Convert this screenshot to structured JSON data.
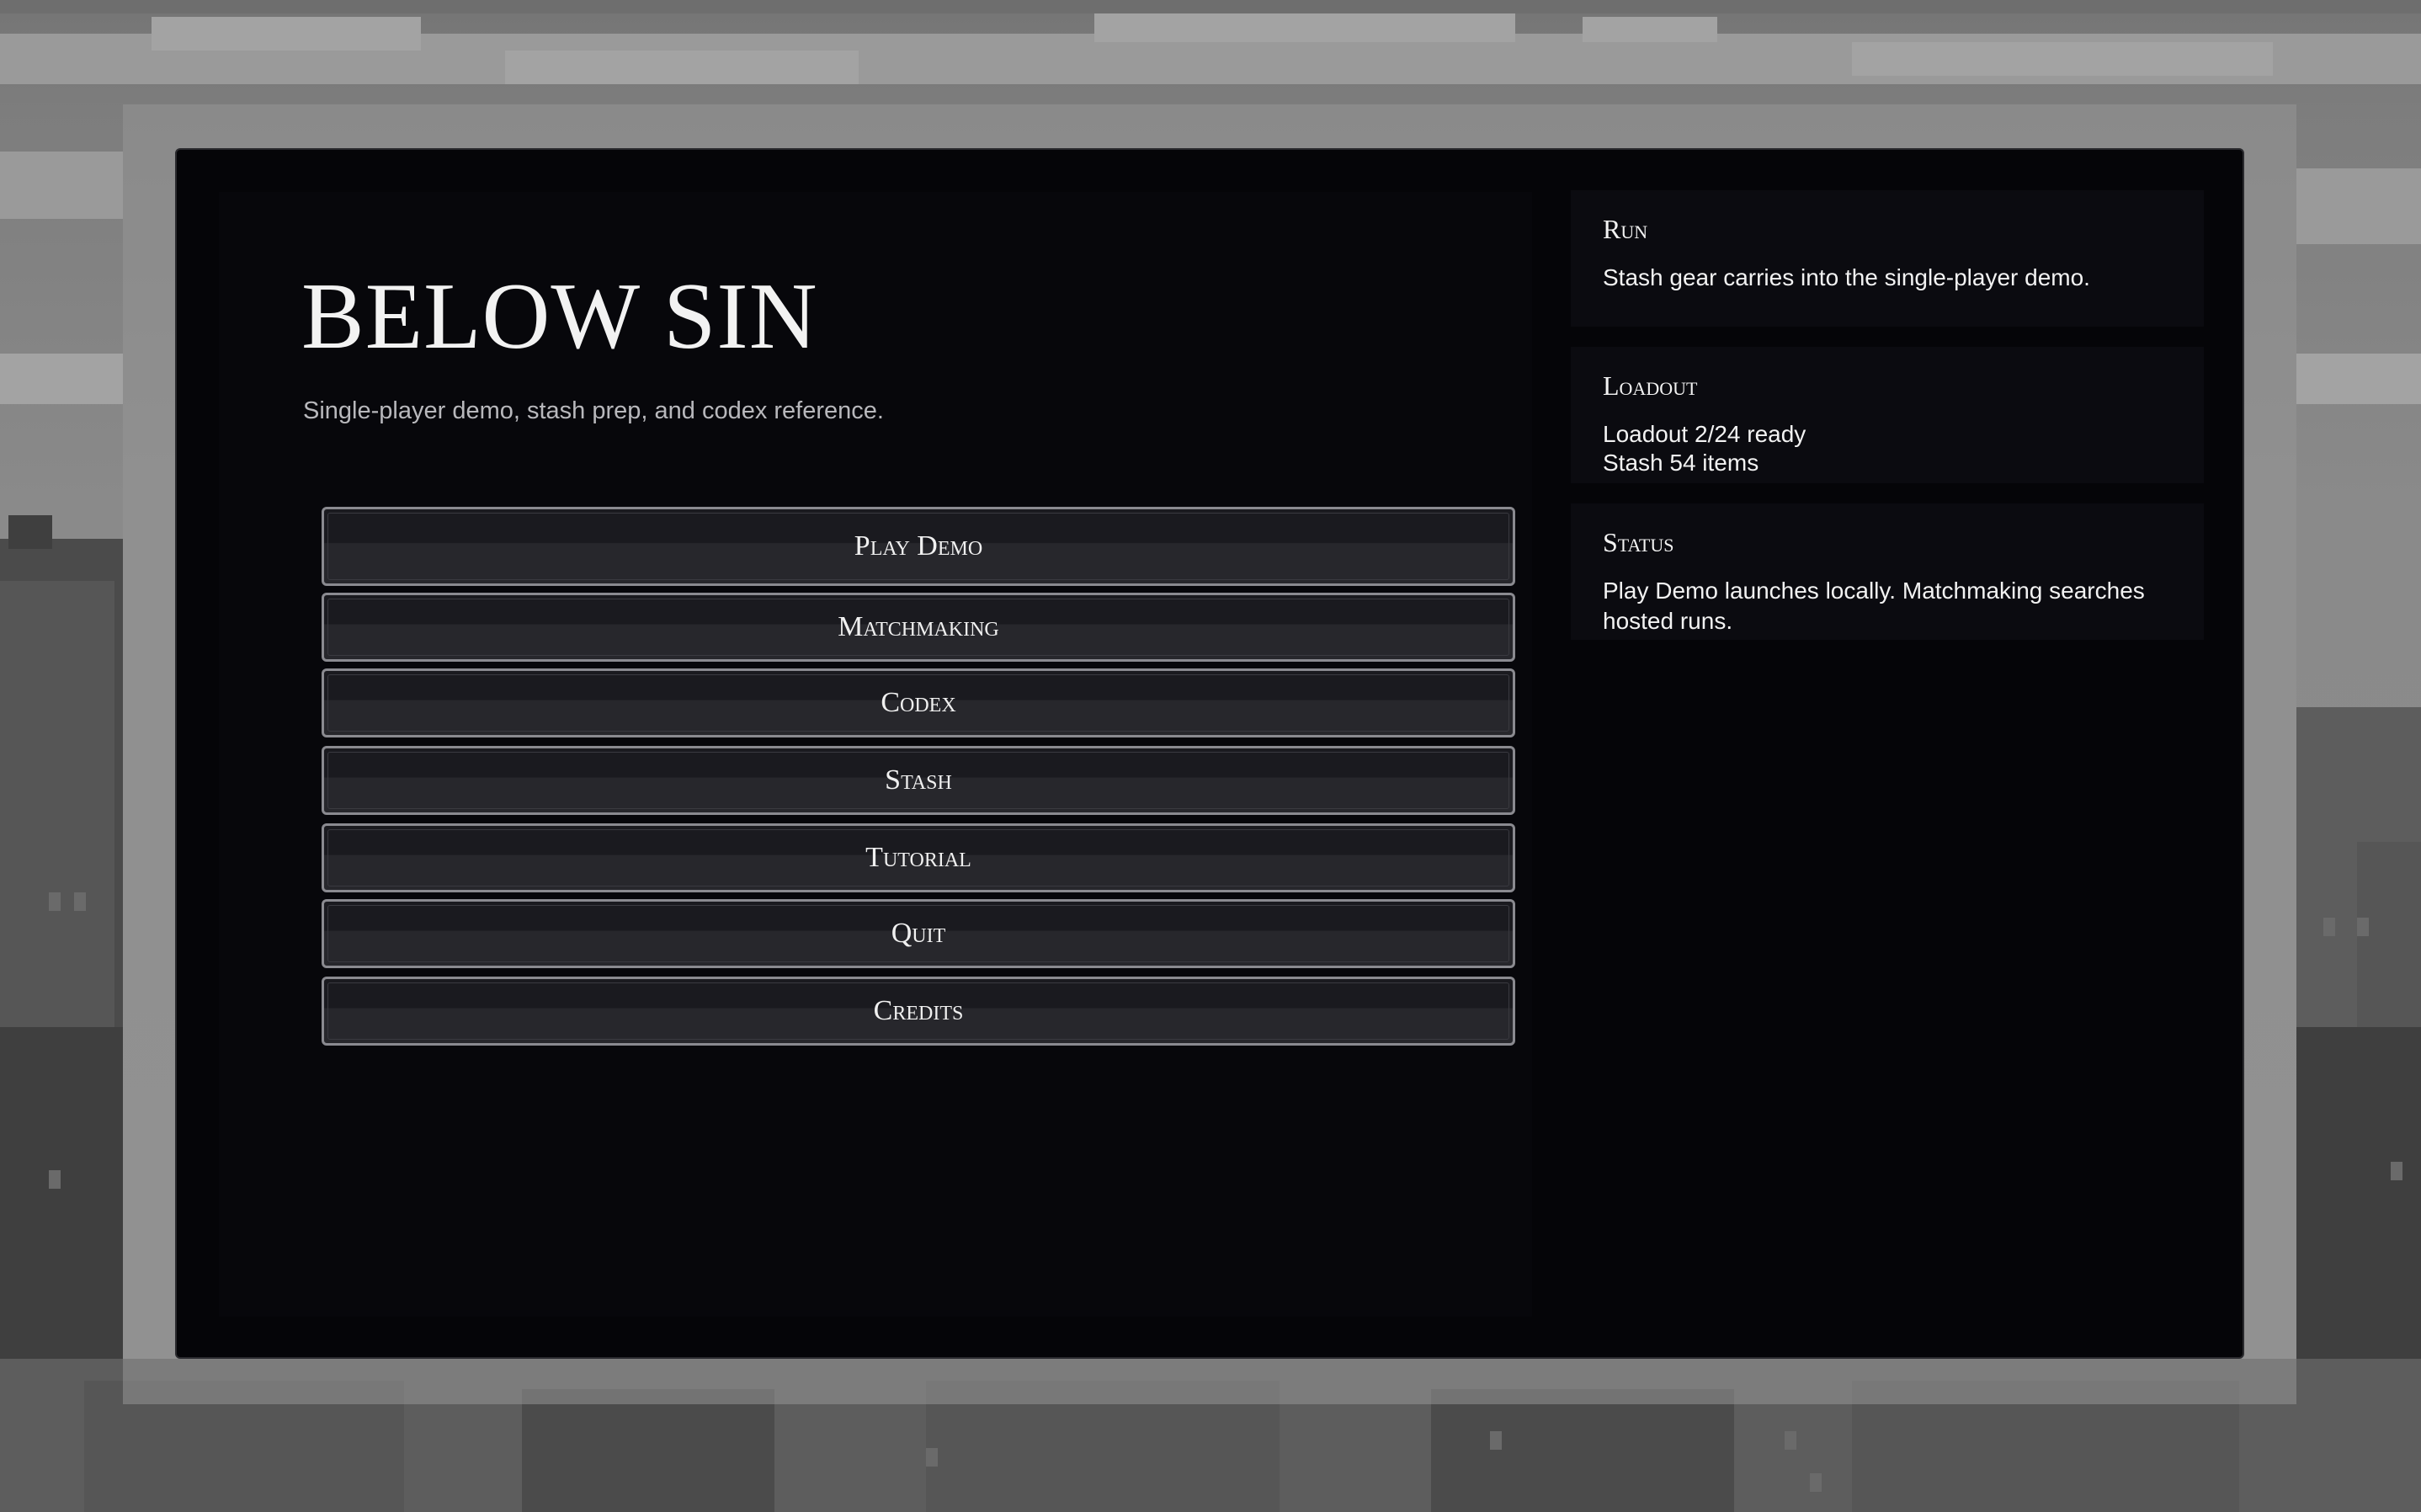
{
  "game": {
    "title": "BELOW SIN",
    "subtitle": "Single-player demo, stash prep, and codex reference."
  },
  "menu": {
    "items": [
      {
        "label": "Play Demo"
      },
      {
        "label": "Matchmaking"
      },
      {
        "label": "Codex"
      },
      {
        "label": "Stash"
      },
      {
        "label": "Tutorial"
      },
      {
        "label": "Quit"
      },
      {
        "label": "Credits"
      }
    ]
  },
  "sidebar": {
    "run": {
      "heading": "Run",
      "text": "Stash gear carries into the single-player demo."
    },
    "loadout": {
      "heading": "Loadout",
      "ready": "Loadout 2/24 ready",
      "stash": "Stash 54 items"
    },
    "status": {
      "heading": "Status",
      "text": "Play Demo launches locally. Matchmaking searches hosted runs."
    }
  }
}
